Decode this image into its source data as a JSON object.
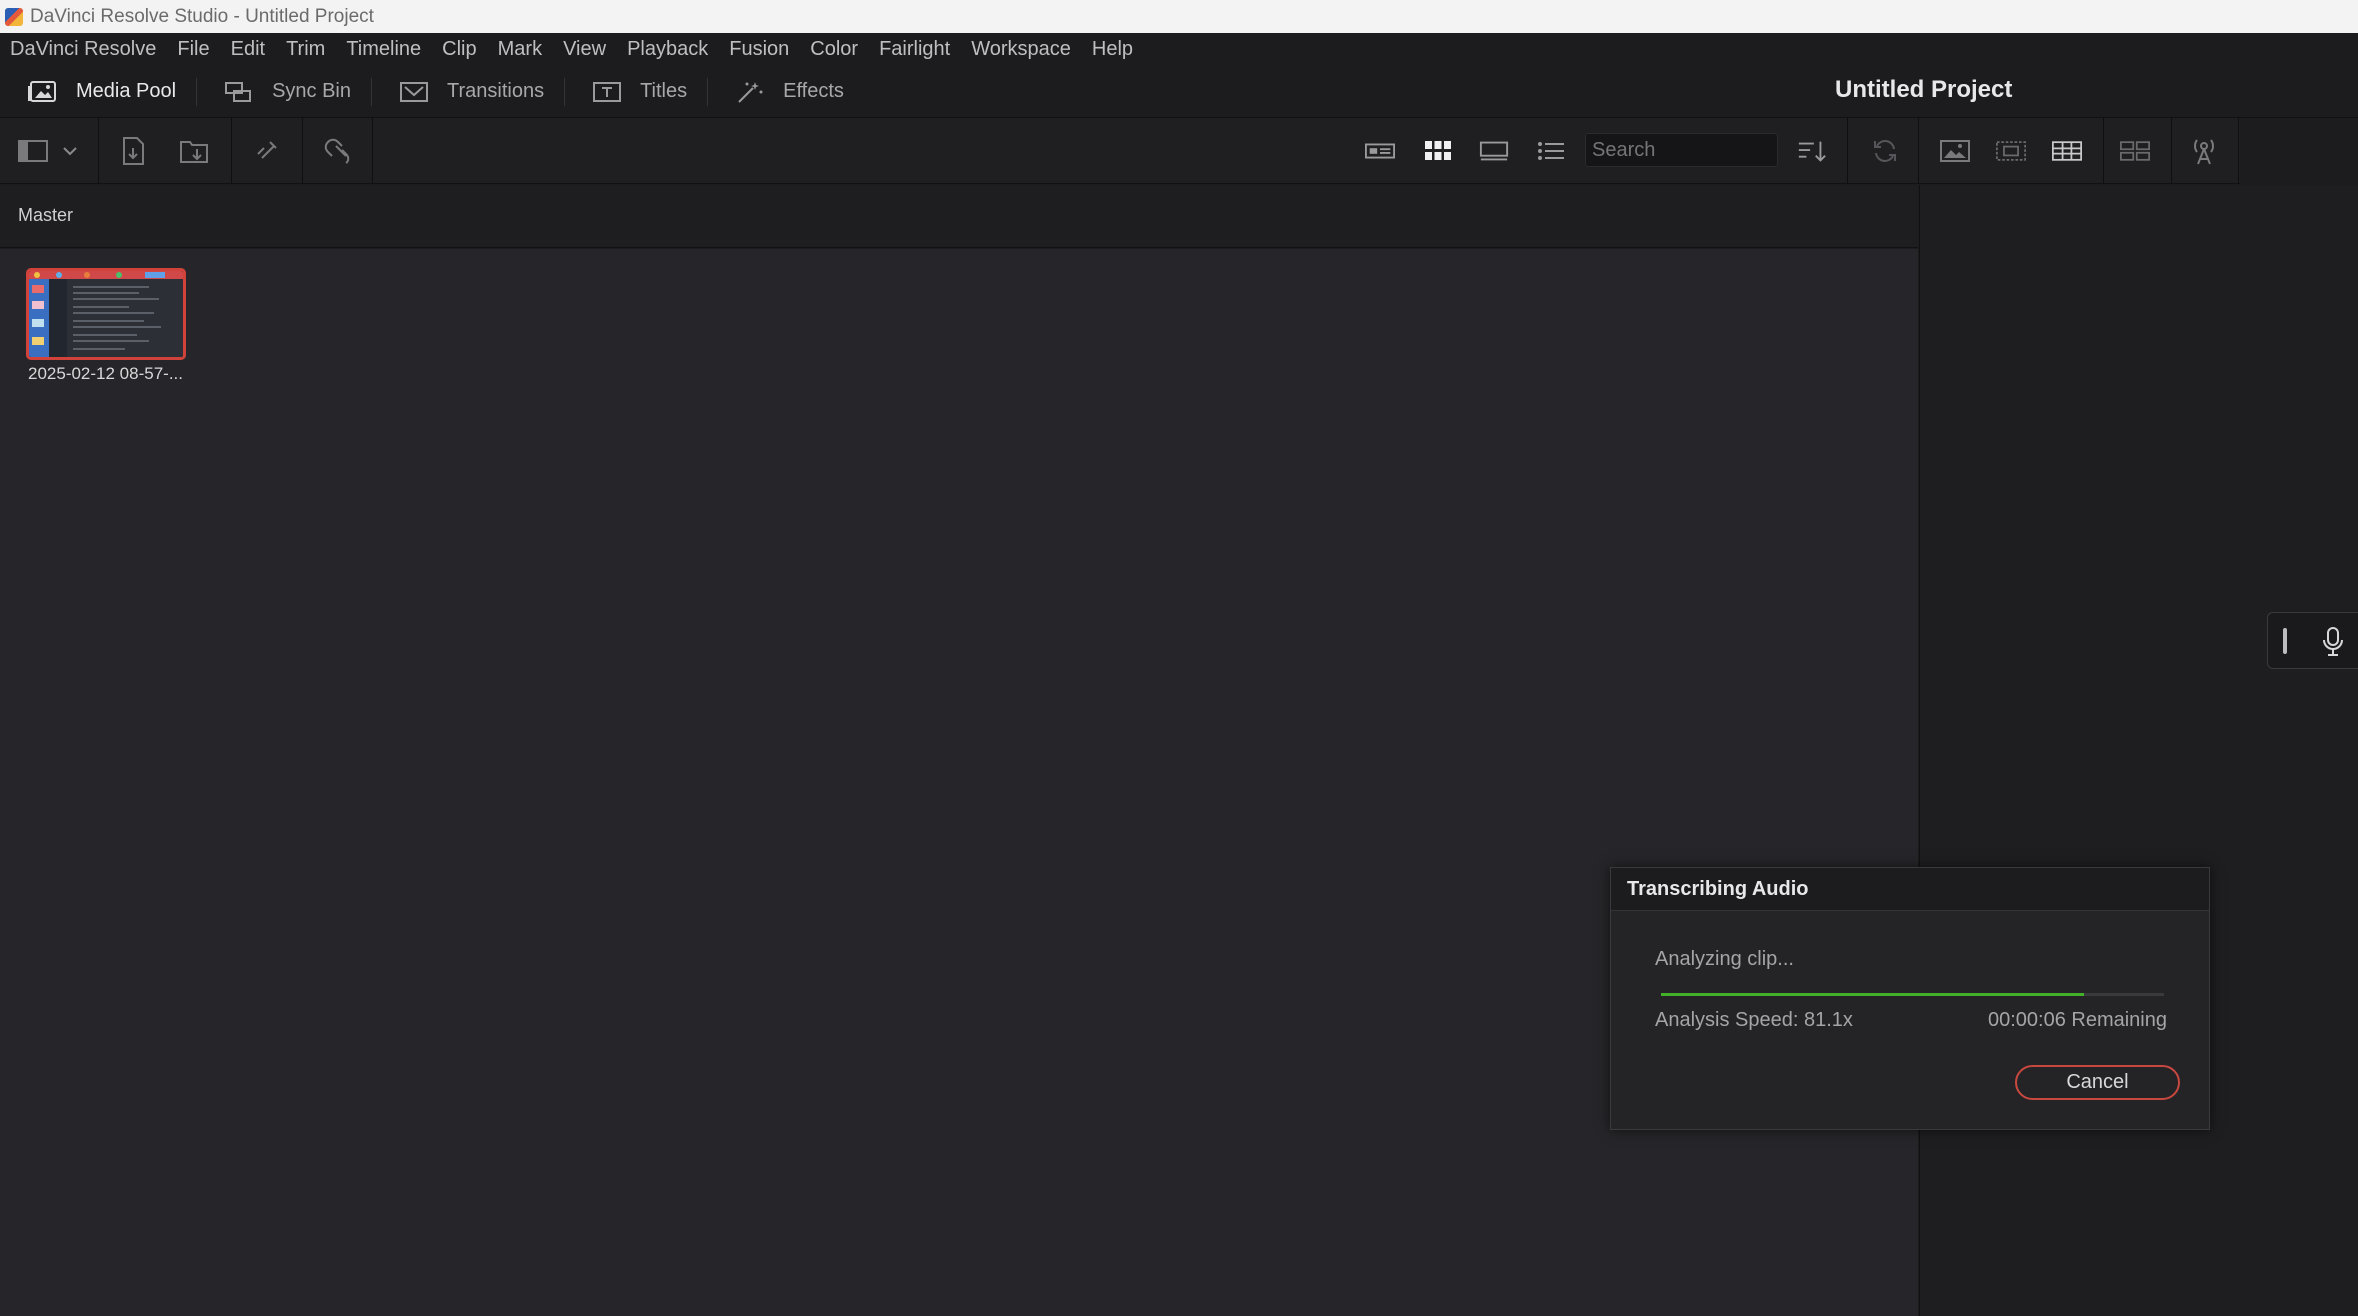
{
  "window": {
    "title": "DaVinci Resolve Studio - Untitled Project"
  },
  "menu": {
    "items": [
      "DaVinci Resolve",
      "File",
      "Edit",
      "Trim",
      "Timeline",
      "Clip",
      "Mark",
      "View",
      "Playback",
      "Fusion",
      "Color",
      "Fairlight",
      "Workspace",
      "Help"
    ]
  },
  "modes": {
    "items": [
      {
        "label": "Media Pool",
        "icon": "media-pool-icon",
        "active": true
      },
      {
        "label": "Sync Bin",
        "icon": "sync-bin-icon",
        "active": false
      },
      {
        "label": "Transitions",
        "icon": "transitions-icon",
        "active": false
      },
      {
        "label": "Titles",
        "icon": "titles-icon",
        "active": false
      },
      {
        "label": "Effects",
        "icon": "effects-icon",
        "active": false
      }
    ]
  },
  "project": {
    "title": "Untitled Project"
  },
  "search": {
    "placeholder": "Search"
  },
  "breadcrumb": {
    "label": "Master"
  },
  "clips": [
    {
      "label": "2025-02-12 08-57-..."
    }
  ],
  "dialog": {
    "title": "Transcribing Audio",
    "status": "Analyzing clip...",
    "progress": 0.84,
    "speed": "Analysis Speed: 81.1x",
    "remaining": "00:00:06 Remaining",
    "cancel_label": "Cancel"
  },
  "colors": {
    "accent_green": "#43b02a",
    "cancel_red": "#c8483f",
    "clip_border": "#d0423a"
  }
}
